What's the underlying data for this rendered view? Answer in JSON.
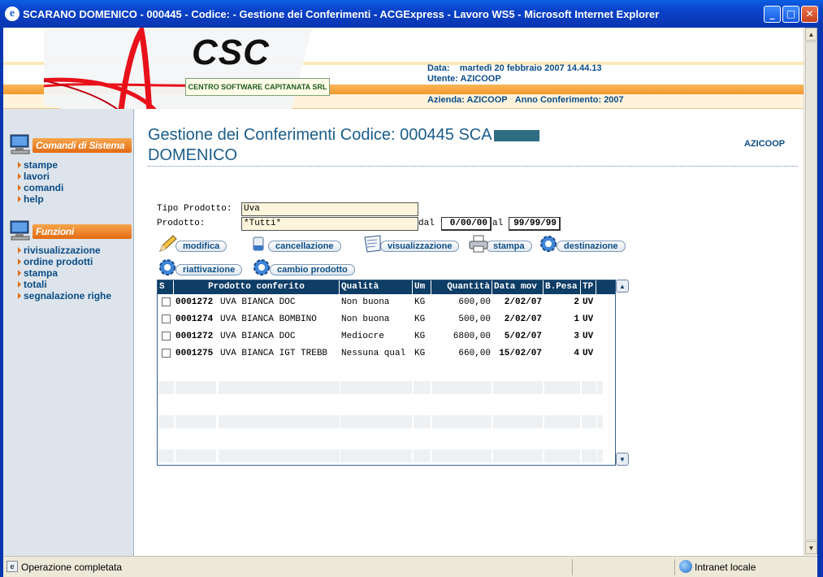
{
  "window": {
    "title": "SCARANO DOMENICO - 000445 - Codice: - Gestione dei Conferimenti - ACGExpress - Lavoro WS5 - Microsoft Internet Explorer"
  },
  "header": {
    "logo_text": "CSC",
    "logo_sub": "CENTRO SOFTWARE CAPITANATA SRL",
    "data_label": "Data:",
    "data_value": "martedì 20 febbraio 2007 14.44.13",
    "utente_label": "Utente:",
    "utente_value": "AZICOOP",
    "azienda_label": "Azienda:",
    "azienda_value": "AZICOOP",
    "anno_label": "Anno Conferimento:",
    "anno_value": "2007"
  },
  "sidebar": {
    "section1": "Comandi di Sistema",
    "section1_items": [
      "stampe",
      "lavori",
      "comandi",
      "help"
    ],
    "section2": "Funzioni",
    "section2_items": [
      "rivisualizzazione",
      "ordine prodotti",
      "stampa",
      "totali",
      "segnalazione righe"
    ]
  },
  "main": {
    "title_line1": "Gestione dei Conferimenti Codice: 000445 SCA",
    "title_line2": "DOMENICO",
    "user": "AZICOOP",
    "tipo_label": "Tipo Prodotto:",
    "tipo_value": "Uva",
    "prodotto_label": "Prodotto:",
    "prodotto_value": "*Tutti*",
    "dal_label": "dal",
    "dal_value": "0/00/00",
    "al_label": "al",
    "al_value": "99/99/99"
  },
  "actions": [
    "modifica",
    "cancellazione",
    "visualizzazione",
    "stampa",
    "destinazione",
    "riattivazione",
    "cambio prodotto"
  ],
  "table": {
    "columns": [
      "S",
      "Prodotto conferito",
      "Qualità",
      "Um",
      "Quantità",
      "Data mov",
      "B.Pesa",
      "TP"
    ],
    "rows": [
      {
        "code": "0001272",
        "prodotto": "UVA BIANCA DOC",
        "qualita": "Non buona",
        "um": "KG",
        "quantita": "600,00",
        "data": "2/02/07",
        "pesa": "2",
        "tp": "UV"
      },
      {
        "code": "0001274",
        "prodotto": "UVA BIANCA BOMBINO",
        "qualita": "Non buona",
        "um": "KG",
        "quantita": "500,00",
        "data": "2/02/07",
        "pesa": "1",
        "tp": "UV"
      },
      {
        "code": "0001272",
        "prodotto": "UVA BIANCA DOC",
        "qualita": "Mediocre",
        "um": "KG",
        "quantita": "6800,00",
        "data": "5/02/07",
        "pesa": "3",
        "tp": "UV"
      },
      {
        "code": "0001275",
        "prodotto": "UVA BIANCA IGT TREBB",
        "qualita": "Nessuna qual",
        "um": "KG",
        "quantita": "660,00",
        "data": "15/02/07",
        "pesa": "4",
        "tp": "UV"
      }
    ]
  },
  "status": {
    "text": "Operazione completata",
    "zone": "Intranet locale"
  }
}
